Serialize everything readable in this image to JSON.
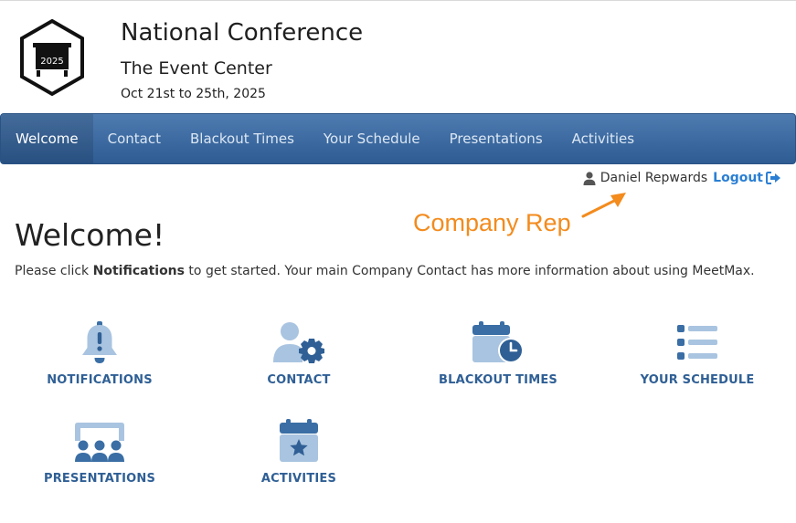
{
  "header": {
    "logo_year": "2025",
    "conference_title": "National Conference",
    "venue": "The Event Center",
    "dates": "Oct 21st to 25th, 2025"
  },
  "nav": {
    "items": [
      {
        "label": "Welcome",
        "active": true
      },
      {
        "label": "Contact"
      },
      {
        "label": "Blackout Times"
      },
      {
        "label": "Your Schedule"
      },
      {
        "label": "Presentations"
      },
      {
        "label": "Activities"
      }
    ]
  },
  "user": {
    "name": "Daniel Repwards",
    "logout_label": "Logout",
    "user_icon": "user-icon",
    "logout_icon": "sign-out-icon"
  },
  "annotation": {
    "text": "Company Rep",
    "color": "#f38b1d"
  },
  "main": {
    "title": "Welcome!",
    "intro_prefix": "Please click ",
    "intro_bold": "Notifications",
    "intro_suffix": " to get started. Your main Company Contact has more information about using MeetMax."
  },
  "tiles": [
    {
      "label": "NOTIFICATIONS",
      "icon": "bell-icon"
    },
    {
      "label": "CONTACT",
      "icon": "user-gear-icon"
    },
    {
      "label": "BLACKOUT TIMES",
      "icon": "calendar-clock-icon"
    },
    {
      "label": "YOUR SCHEDULE",
      "icon": "list-icon"
    },
    {
      "label": "PRESENTATIONS",
      "icon": "presentation-icon"
    },
    {
      "label": "ACTIVITIES",
      "icon": "calendar-star-icon"
    }
  ],
  "colors": {
    "nav_top": "#4e7bb0",
    "nav_bottom": "#2e5c93",
    "tile_label": "#2f5f95",
    "icon_dark": "#3a6ea5",
    "icon_light": "#a9c4e0",
    "link": "#2a7fd4"
  }
}
